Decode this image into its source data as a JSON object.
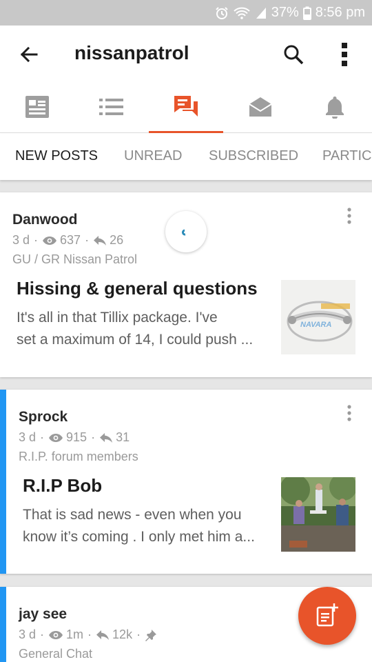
{
  "colors": {
    "accent": "#e8542a",
    "unread_bar": "#2196f3",
    "icon_gray": "#9e9e9e"
  },
  "status_bar": {
    "battery": "37%",
    "time": "8:56 pm",
    "icons": [
      "alarm-icon",
      "wifi-icon",
      "signal-icon",
      "battery-icon"
    ]
  },
  "app_bar": {
    "title": "nissanpatrol",
    "icons": [
      "back-arrow-icon",
      "search-icon",
      "more-vert-icon"
    ]
  },
  "icon_tabs": [
    {
      "name": "forum-home-icon",
      "active": false
    },
    {
      "name": "list-icon",
      "active": false
    },
    {
      "name": "discussions-icon",
      "active": true
    },
    {
      "name": "inbox-icon",
      "active": false
    },
    {
      "name": "notifications-icon",
      "active": false
    }
  ],
  "sub_tabs": [
    {
      "label": "NEW POSTS",
      "active": true
    },
    {
      "label": "UNREAD",
      "active": false
    },
    {
      "label": "SUBSCRIBED",
      "active": false
    },
    {
      "label": "PARTIC",
      "active": false
    }
  ],
  "posts": [
    {
      "author": "Danwood",
      "age": "3 d",
      "views": "637",
      "replies": "26",
      "forum": "GU / GR Nissan Patrol",
      "title": "Hissing & general questions",
      "excerpt_line1": "It's all in that Tillix package. I've",
      "excerpt_line2": "set a maximum of 14, I could push ...",
      "unread": false,
      "thumb_text": "NAVARA"
    },
    {
      "author": "Sprock",
      "age": "3 d",
      "views": "915",
      "replies": "31",
      "forum": "R.I.P. forum members",
      "title": "R.I.P Bob",
      "excerpt_line1": "That is sad news - even when you",
      "excerpt_line2": "know it’s coming . I only met him a...",
      "unread": true
    },
    {
      "author": "jay see",
      "age": "3 d",
      "views": "1m",
      "replies": "12k",
      "forum": "General Chat",
      "pinned": true,
      "unread": true
    }
  ],
  "fab": {
    "icon": "new-post-icon"
  }
}
